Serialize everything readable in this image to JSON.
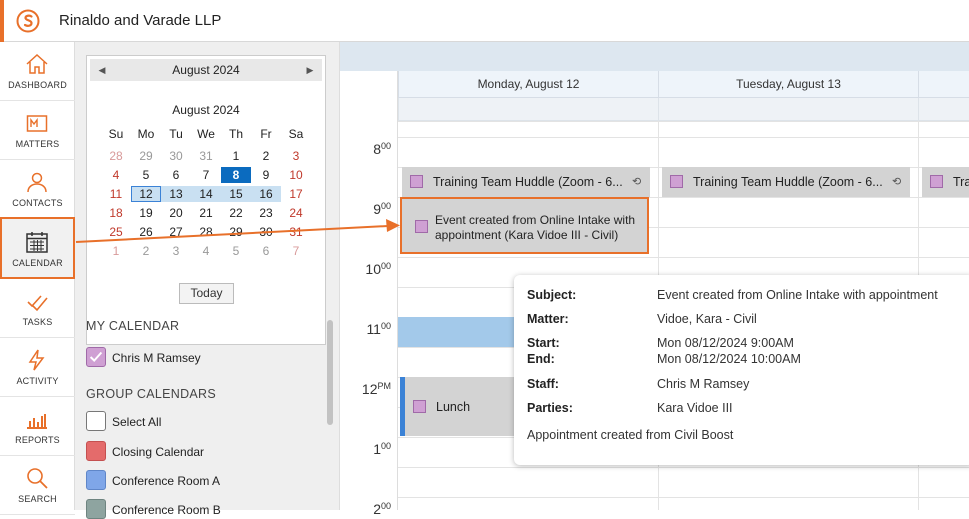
{
  "app": {
    "firm_name": "Rinaldo and Varade LLP",
    "accent": "#e8702a"
  },
  "nav": [
    {
      "label": "DASHBOARD",
      "icon": "house-icon"
    },
    {
      "label": "MATTERS",
      "icon": "briefcase-m-icon"
    },
    {
      "label": "CONTACTS",
      "icon": "contacts-icon"
    },
    {
      "label": "CALENDAR",
      "icon": "calendar-icon",
      "active": true
    },
    {
      "label": "TASKS",
      "icon": "tasks-check-icon"
    },
    {
      "label": "ACTIVITY",
      "icon": "lightning-icon"
    },
    {
      "label": "REPORTS",
      "icon": "bar-chart-icon"
    },
    {
      "label": "SEARCH",
      "icon": "search-icon"
    }
  ],
  "mini_calendar": {
    "header": "August 2024",
    "month_title": "August 2024",
    "weekdays": [
      "Su",
      "Mo",
      "Tu",
      "We",
      "Th",
      "Fr",
      "Sa"
    ],
    "weeks": [
      [
        "28",
        "29",
        "30",
        "31",
        "1",
        "2",
        "3"
      ],
      [
        "4",
        "5",
        "6",
        "7",
        "8",
        "9",
        "10"
      ],
      [
        "11",
        "12",
        "13",
        "14",
        "15",
        "16",
        "17"
      ],
      [
        "18",
        "19",
        "20",
        "21",
        "22",
        "23",
        "24"
      ],
      [
        "25",
        "26",
        "27",
        "28",
        "29",
        "30",
        "31"
      ],
      [
        "1",
        "2",
        "3",
        "4",
        "5",
        "6",
        "7"
      ]
    ],
    "today": "8",
    "selected": "12",
    "today_button": "Today"
  },
  "my_calendar": {
    "title": "MY CALENDAR",
    "items": [
      {
        "label": "Chris M Ramsey",
        "color": "#cfa0d3",
        "checked": true
      }
    ]
  },
  "group_calendars": {
    "title": "GROUP CALENDARS",
    "items": [
      {
        "label": "Select All",
        "color": "#ffffff"
      },
      {
        "label": "Closing Calendar",
        "color": "#e46b6b"
      },
      {
        "label": "Conference Room A",
        "color": "#7fa6e8"
      },
      {
        "label": "Conference Room B",
        "color": "#8ea4a0"
      }
    ]
  },
  "calendar": {
    "days": [
      "Monday, August 12",
      "Tuesday, August 13"
    ],
    "times": [
      {
        "h": "8",
        "s": "00"
      },
      {
        "h": "9",
        "s": "00"
      },
      {
        "h": "10",
        "s": "00"
      },
      {
        "h": "11",
        "s": "00"
      },
      {
        "h": "12",
        "s": "PM"
      },
      {
        "h": "1",
        "s": "00"
      },
      {
        "h": "2",
        "s": "00"
      }
    ],
    "events": {
      "huddle_mon": "Training Team Huddle  (Zoom - 6...",
      "huddle_tue": "Training Team Huddle  (Zoom - 6...",
      "huddle_wed": "Tra",
      "intake": "Event created from Online Intake with appointment (Kara Vidoe III - Civil)",
      "lunch": "Lunch"
    }
  },
  "tooltip": {
    "subject_label": "Subject:",
    "subject": "Event created from Online Intake with appointment",
    "matter_label": "Matter:",
    "matter": "Vidoe, Kara - Civil",
    "start_label": "Start:",
    "start": "Mon 08/12/2024 9:00AM",
    "end_label": "End:",
    "end": "Mon 08/12/2024 10:00AM",
    "staff_label": "Staff:",
    "staff": "Chris M Ramsey",
    "parties_label": "Parties:",
    "parties": "Kara Vidoe III",
    "note": "Appointment created from Civil Boost"
  }
}
